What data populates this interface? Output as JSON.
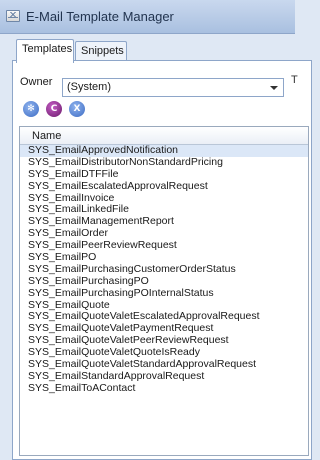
{
  "window": {
    "title": "E-Mail Template Manager"
  },
  "tabs": [
    {
      "label": "Templates",
      "active": true
    },
    {
      "label": "Snippets",
      "active": false
    }
  ],
  "owner": {
    "label": "Owner",
    "value": "(System)",
    "stray": "T"
  },
  "toolbar": {
    "buttons": [
      {
        "icon": "gear-icon",
        "glyph": "✻"
      },
      {
        "icon": "c-icon",
        "glyph": "C"
      },
      {
        "icon": "close-x-icon",
        "glyph": "X"
      }
    ]
  },
  "grid": {
    "header": "Name",
    "rows": [
      "SYS_EmailApprovedNotification",
      "SYS_EmailDistributorNonStandardPricing",
      "SYS_EmailDTFFile",
      "SYS_EmailEscalatedApprovalRequest",
      "SYS_EmailInvoice",
      "SYS_EmailLinkedFile",
      "SYS_EmailManagementReport",
      "SYS_EmailOrder",
      "SYS_EmailPeerReviewRequest",
      "SYS_EmailPO",
      "SYS_EmailPurchasingCustomerOrderStatus",
      "SYS_EmailPurchasingPO",
      "SYS_EmailPurchasingPOInternalStatus",
      "SYS_EmailQuote",
      "SYS_EmailQuoteValetEscalatedApprovalRequest",
      "SYS_EmailQuoteValetPaymentRequest",
      "SYS_EmailQuoteValetPeerReviewRequest",
      "SYS_EmailQuoteValetQuoteIsReady",
      "SYS_EmailQuoteValetStandardApprovalRequest",
      "SYS_EmailStandardApprovalRequest",
      "SYS_EmailToAContact"
    ]
  }
}
